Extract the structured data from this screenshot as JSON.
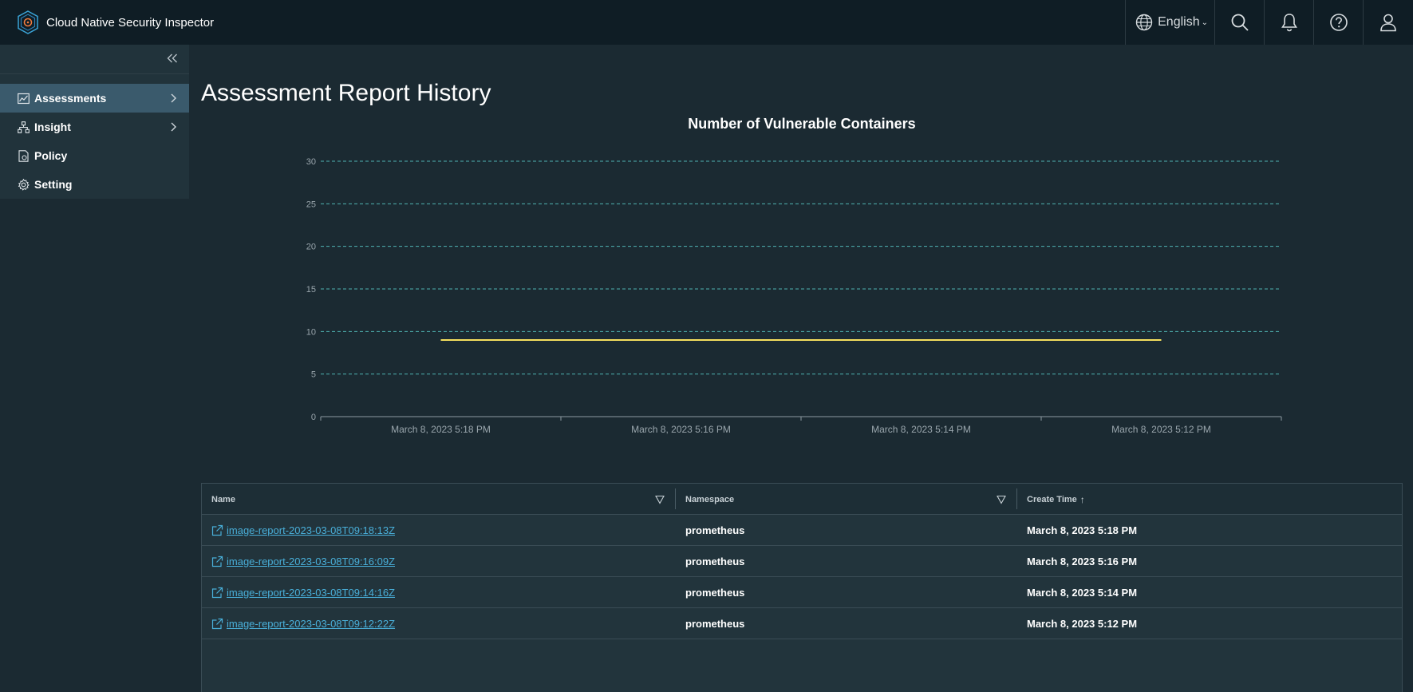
{
  "app": {
    "title": "Cloud Native Security Inspector",
    "language": "English"
  },
  "header_icons": [
    "globe-icon",
    "search-icon",
    "bell-icon",
    "help-icon",
    "user-icon"
  ],
  "sidebar": {
    "items": [
      {
        "label": "Assessments",
        "icon": "chart-icon",
        "has_children": true,
        "active": true
      },
      {
        "label": "Insight",
        "icon": "network-icon",
        "has_children": true,
        "active": false
      },
      {
        "label": "Policy",
        "icon": "policy-icon",
        "has_children": false,
        "active": false
      },
      {
        "label": "Setting",
        "icon": "gear-icon",
        "has_children": false,
        "active": false
      }
    ]
  },
  "page": {
    "title": "Assessment Report History"
  },
  "chart_data": {
    "type": "line",
    "title": "Number of Vulnerable Containers",
    "x": [
      "March 8, 2023 5:18 PM",
      "March 8, 2023 5:16 PM",
      "March 8, 2023 5:14 PM",
      "March 8, 2023 5:12 PM"
    ],
    "series": [
      {
        "values": [
          9,
          9,
          9,
          9
        ],
        "color": "#f6e05e"
      }
    ],
    "yticks": [
      0,
      5,
      10,
      15,
      20,
      25,
      30
    ],
    "ylim": [
      0,
      30
    ],
    "grid": true,
    "grid_color": "#4fb3b3"
  },
  "table": {
    "columns": [
      {
        "label": "Name",
        "filter": true
      },
      {
        "label": "Namespace",
        "filter": true
      },
      {
        "label": "Create Time",
        "sort": "↑"
      }
    ],
    "rows": [
      {
        "name": "image-report-2023-03-08T09:18:13Z",
        "namespace": "prometheus",
        "create_time": "March 8, 2023 5:18 PM"
      },
      {
        "name": "image-report-2023-03-08T09:16:09Z",
        "namespace": "prometheus",
        "create_time": "March 8, 2023 5:16 PM"
      },
      {
        "name": "image-report-2023-03-08T09:14:16Z",
        "namespace": "prometheus",
        "create_time": "March 8, 2023 5:14 PM"
      },
      {
        "name": "image-report-2023-03-08T09:12:22Z",
        "namespace": "prometheus",
        "create_time": "March 8, 2023 5:12 PM"
      }
    ]
  }
}
